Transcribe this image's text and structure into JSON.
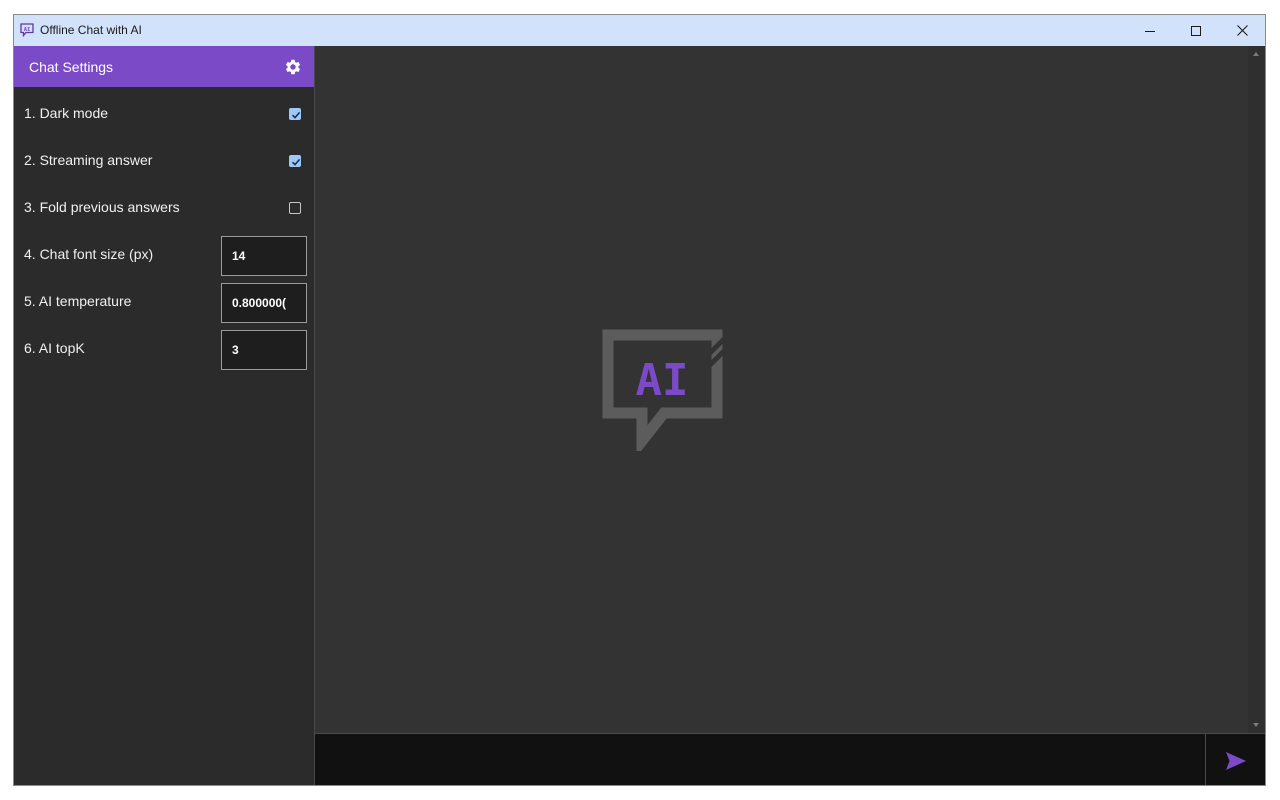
{
  "window": {
    "title": "Offline Chat with AI",
    "icon": "chat-ai-app-icon",
    "controls": [
      "minimize-icon",
      "maximize-icon",
      "close-icon"
    ]
  },
  "sidebar": {
    "title": "Chat Settings",
    "header_icon": "gear-icon",
    "settings": [
      {
        "label": "1. Dark mode",
        "type": "checkbox",
        "checked": true
      },
      {
        "label": "2. Streaming answer",
        "type": "checkbox",
        "checked": true
      },
      {
        "label": "3. Fold previous answers",
        "type": "checkbox",
        "checked": false
      },
      {
        "label": "4. Chat font size (px)",
        "type": "number",
        "value": "14"
      },
      {
        "label": "5. AI temperature",
        "type": "number",
        "value": "0.800000("
      },
      {
        "label": "6. AI topK",
        "type": "number",
        "value": "3"
      }
    ]
  },
  "main": {
    "logo_text": "AI",
    "logo_icon": "chat-bubble-ai-icon"
  },
  "input_bar": {
    "value": "",
    "send_icon": "send-arrow-icon"
  },
  "colors": {
    "accent": "#7b4ac6",
    "titlebar": "#d3e2fb",
    "background": "#333333",
    "sidebar": "#2b2b2b",
    "input": "#111111"
  }
}
